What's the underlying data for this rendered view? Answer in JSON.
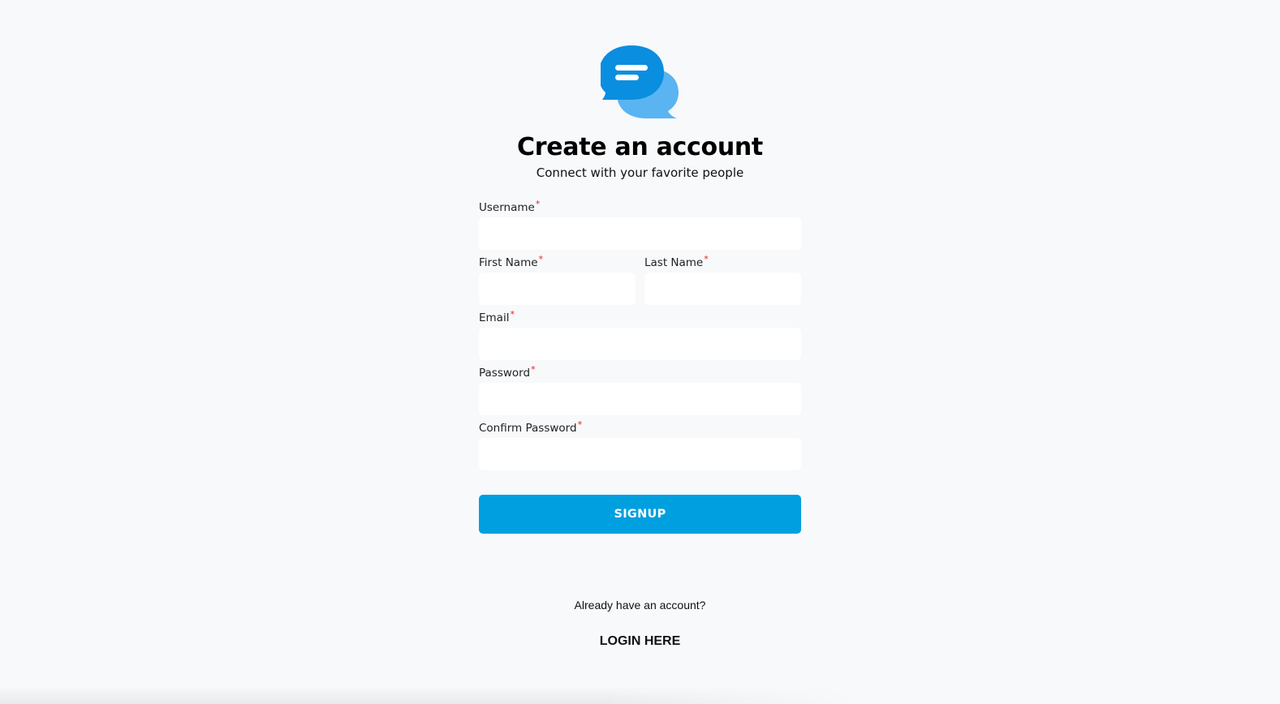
{
  "brand": {
    "logo_icon": "chat-bubbles-icon",
    "primary_color": "#0a8ee0",
    "secondary_color": "#5ab4f2"
  },
  "header": {
    "title": "Create an account",
    "subtitle": "Connect with your favorite people"
  },
  "form": {
    "required_marker": "*",
    "username": {
      "label": "Username",
      "value": "",
      "placeholder": ""
    },
    "first_name": {
      "label": "First Name",
      "value": "",
      "placeholder": ""
    },
    "last_name": {
      "label": "Last Name",
      "value": "",
      "placeholder": ""
    },
    "email": {
      "label": "Email",
      "value": "",
      "placeholder": ""
    },
    "password": {
      "label": "Password",
      "value": "",
      "placeholder": ""
    },
    "confirm_password": {
      "label": "Confirm Password",
      "value": "",
      "placeholder": ""
    },
    "submit_label": "SIGNUP",
    "submit_color": "#009fe0"
  },
  "footer": {
    "prompt": "Already have an account?",
    "login_label": "LOGIN HERE"
  }
}
